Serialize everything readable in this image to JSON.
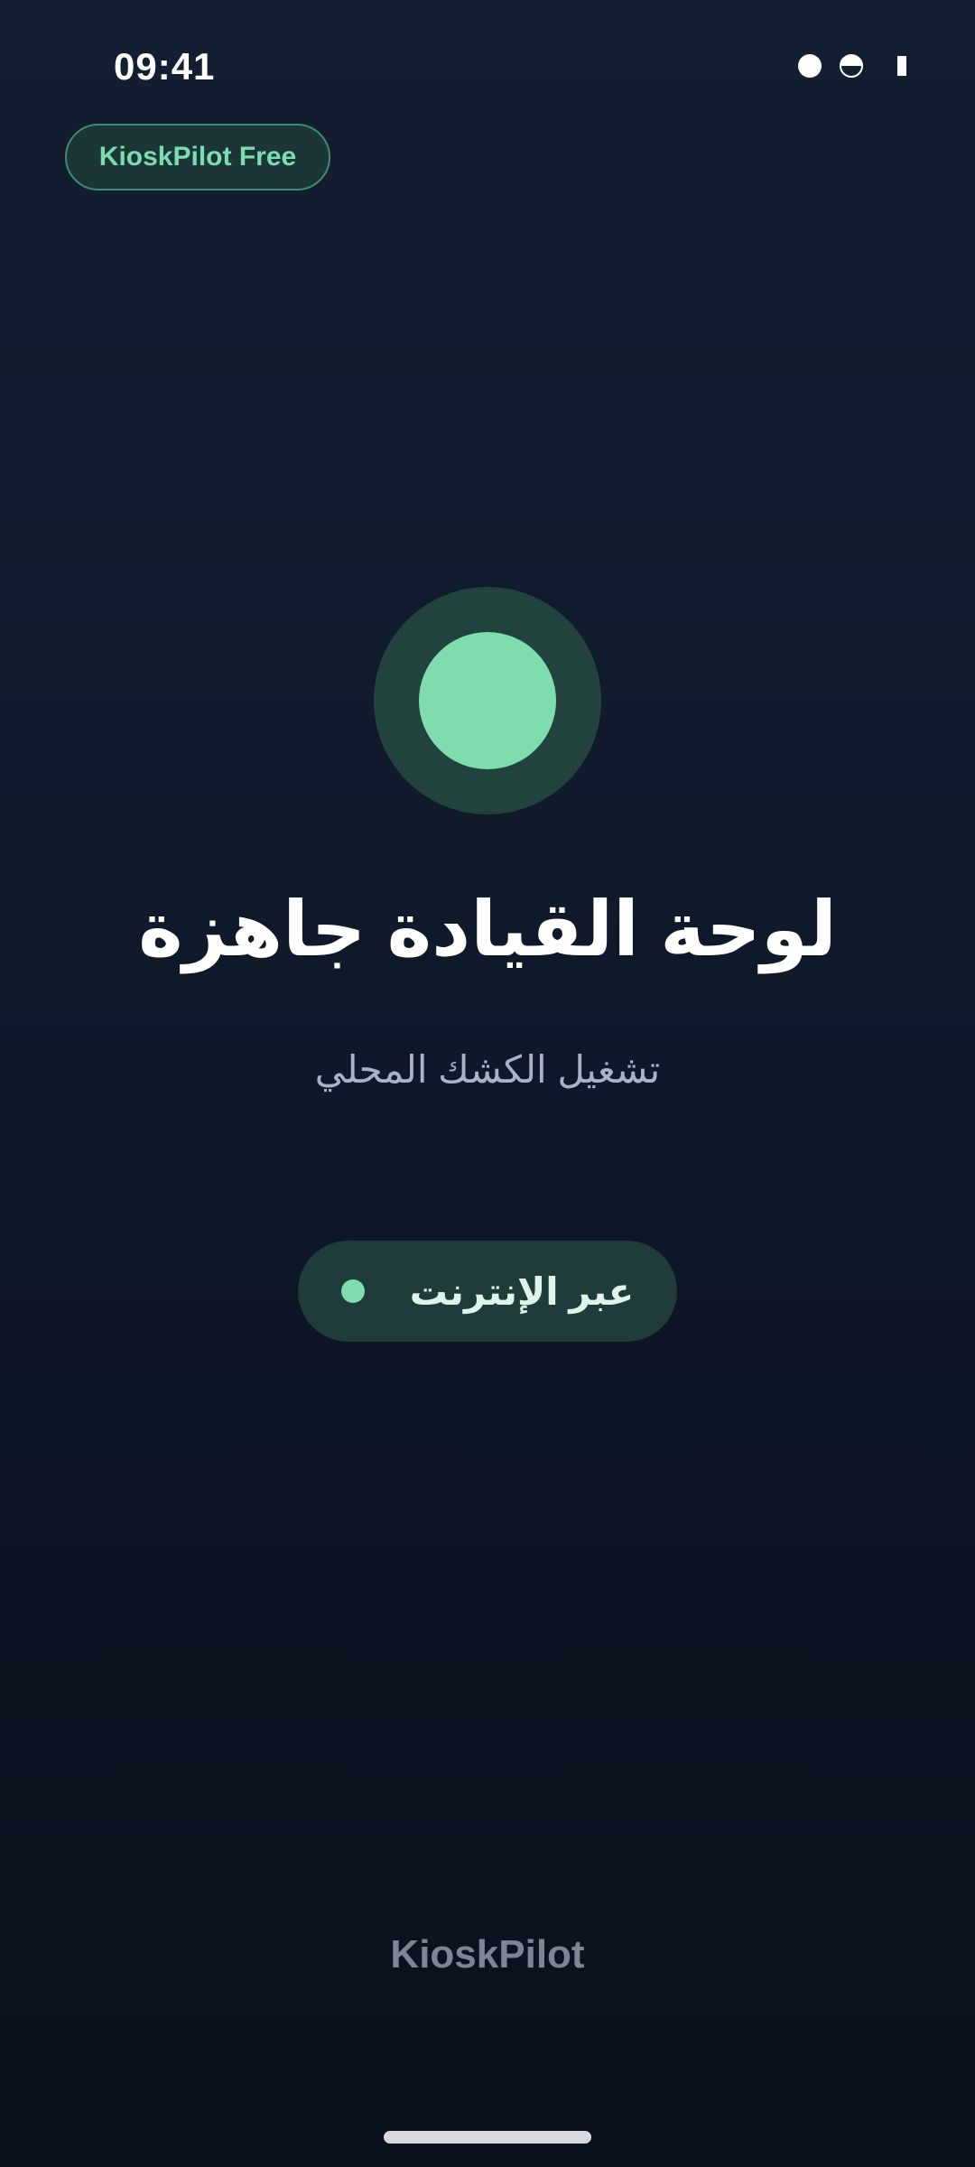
{
  "status_bar": {
    "time": "09:41",
    "icons": [
      "dot-icon",
      "half-circle-icon",
      "battery-bar-icon"
    ]
  },
  "badge": {
    "label": "KioskPilot Free"
  },
  "main": {
    "title": "لوحة القيادة جاهزة",
    "subtitle": "تشغيل الكشك المحلي",
    "connection_label": "عبر الإنترنت"
  },
  "footer": {
    "brand": "KioskPilot"
  },
  "colors": {
    "accent": "#7edcae",
    "background": "#0f192a",
    "ring": "#22423e"
  }
}
